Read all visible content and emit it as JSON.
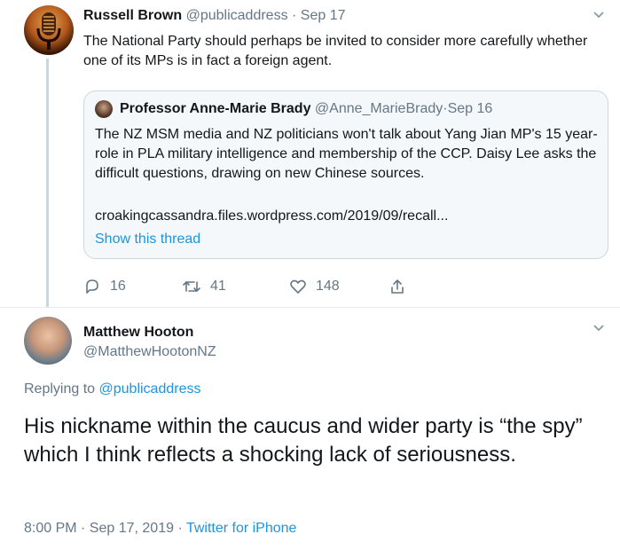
{
  "tweet_1": {
    "author_name": "Russell Brown",
    "author_handle": "@publicaddress",
    "separator": " · ",
    "date": "Sep 17",
    "text": "The National Party should perhaps be invited to consider more carefully whether one of its MPs is in fact a foreign agent.",
    "quoted": {
      "author_name": "Professor Anne-Marie Brady",
      "author_handle": "@Anne_MarieBrady",
      "date": "Sep 16",
      "text": "The NZ MSM media and NZ politicians won't talk about Yang Jian MP's 15 year-role in PLA military intelligence and membership of the CCP. Daisy Lee asks the difficult questions, drawing on new Chinese sources.",
      "link": "croakingcassandra.files.wordpress.com/2019/09/recall...",
      "show_thread": "Show this thread"
    },
    "actions": {
      "replies": "16",
      "retweets": "41",
      "likes": "148"
    }
  },
  "tweet_2": {
    "author_name": "Matthew Hooton",
    "author_handle": "@MatthewHootonNZ",
    "replying_to_label": "Replying to ",
    "replying_to_handle": "@publicaddress",
    "text": "His nickname within the caucus and wider party is “the spy” which I think reflects a shocking lack of seriousness.",
    "timestamp": "8:00 PM · Sep 17, 2019 · ",
    "source": "Twitter for iPhone"
  },
  "colors": {
    "link_blue": "#1b95e0",
    "muted_gray": "#657786",
    "border_gray": "#ccd6dd",
    "quote_bg": "#f5f8fa"
  }
}
